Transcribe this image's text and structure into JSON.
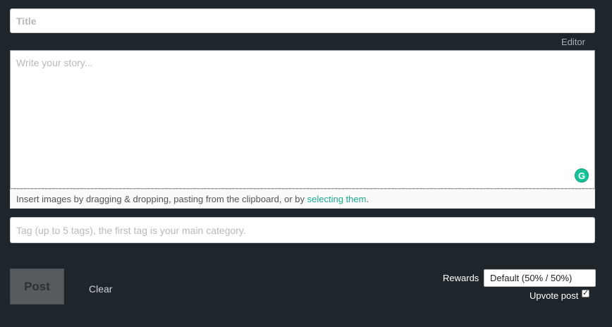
{
  "title": {
    "placeholder": "Title",
    "value": ""
  },
  "editor": {
    "toggle_label": "Editor",
    "placeholder": "Write your story...",
    "value": "",
    "grammarly_glyph": "G"
  },
  "upload": {
    "hint_prefix": "Insert images by dragging & dropping, pasting from the clipboard, or by ",
    "hint_link": "selecting them",
    "hint_suffix": "."
  },
  "tags": {
    "placeholder": "Tag (up to 5 tags), the first tag is your main category.",
    "value": ""
  },
  "actions": {
    "post_label": "Post",
    "clear_label": "Clear"
  },
  "rewards": {
    "label": "Rewards",
    "selected": "Default (50% / 50%)"
  },
  "upvote": {
    "label": "Upvote post",
    "checked": true,
    "check_glyph": "✓"
  },
  "colors": {
    "background": "#1e252b",
    "link": "#1aa98b",
    "grammarly": "#15c39a",
    "post_button": "#555b5f"
  }
}
